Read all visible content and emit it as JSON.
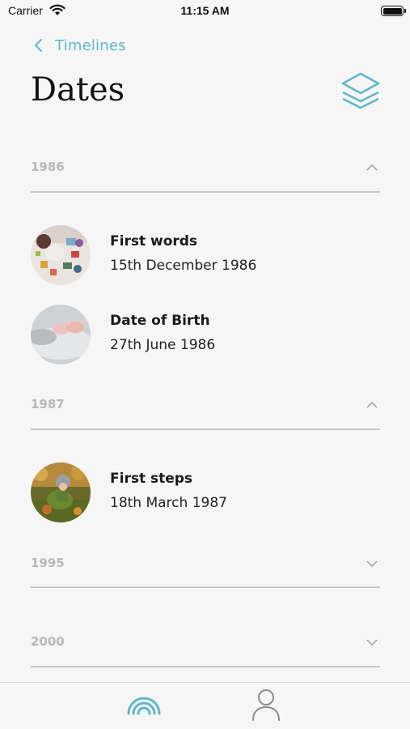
{
  "status_bar": {
    "carrier": "Carrier",
    "time": "11:15 AM",
    "icons": [
      "wifi-icon",
      "battery-icon"
    ]
  },
  "nav": {
    "back_label": "Timelines",
    "back_icon": "chevron-left-icon",
    "title": "Dates",
    "layers_icon": "layers-icon"
  },
  "sections": [
    {
      "year": "1986",
      "expanded": true,
      "chevron_icon": "chevron-up-icon",
      "entries": [
        {
          "title": "First words",
          "date": "15th December 1986",
          "thumbnail": "toddler-with-toys-photo"
        },
        {
          "title": "Date of Birth",
          "date": "27th June 1986",
          "thumbnail": "baby-feet-photo"
        }
      ]
    },
    {
      "year": "1987",
      "expanded": true,
      "chevron_icon": "chevron-up-icon",
      "entries": [
        {
          "title": "First steps",
          "date": "18th March 1987",
          "thumbnail": "child-in-autumn-leaves-photo"
        }
      ]
    },
    {
      "year": "1995",
      "expanded": false,
      "chevron_icon": "chevron-down-icon",
      "entries": []
    },
    {
      "year": "2000",
      "expanded": false,
      "chevron_icon": "chevron-down-icon",
      "entries": []
    }
  ],
  "tab_bar": {
    "tabs": [
      {
        "icon": "rainbow-icon",
        "selected": true
      },
      {
        "icon": "person-icon",
        "selected": false
      }
    ]
  },
  "colors": {
    "accent": "#5eb8c7",
    "background": "#f6f6f6",
    "year_text": "#b8b8b8",
    "divider": "#c8c8c8"
  }
}
